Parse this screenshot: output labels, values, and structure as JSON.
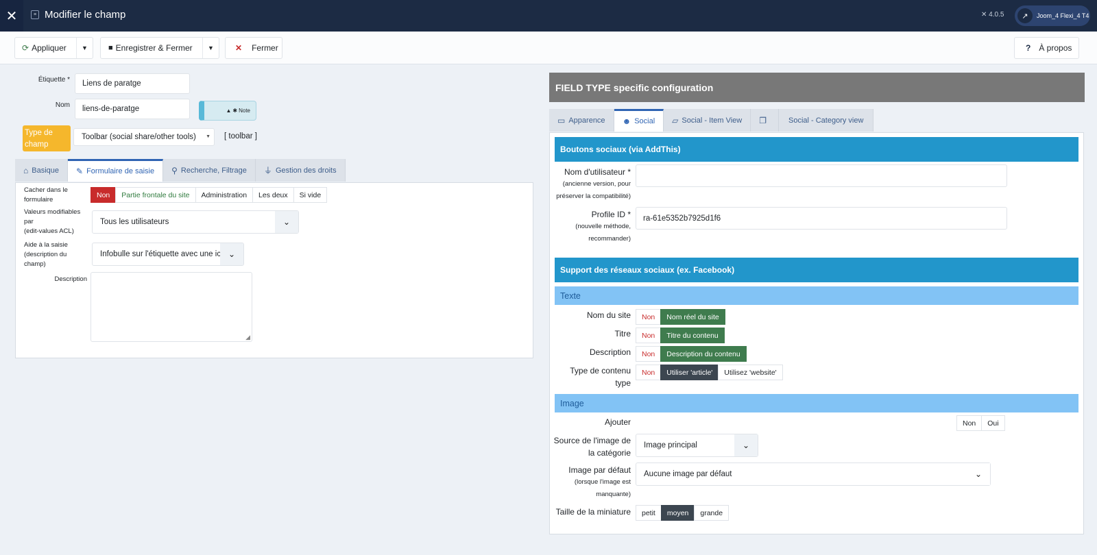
{
  "header": {
    "title": "Modifier le champ",
    "version": "4.0.5",
    "site_name": "Joom_4 Flexi_4 T4"
  },
  "toolbar": {
    "apply": "Appliquer",
    "save_close": "Enregistrer & Fermer",
    "close": "Fermer",
    "about": "À propos"
  },
  "form": {
    "label_label": "Étiquette *",
    "label_value": "Liens de paratge",
    "name_label": "Nom",
    "name_value": "liens-de-paratge",
    "note": "Note",
    "type_label": "Type de champ",
    "type_value": "Toolbar (social share/other tools)",
    "type_code": "[ toolbar ]"
  },
  "left_tabs": [
    {
      "label": "Basique",
      "icon": "home-icon"
    },
    {
      "label": "Formulaire de saisie",
      "icon": "edit-icon"
    },
    {
      "label": "Recherche, Filtrage",
      "icon": "search-icon"
    },
    {
      "label": "Gestion des droits",
      "icon": "plug-icon"
    }
  ],
  "entry_form": {
    "hide_label": "Cacher dans le formulaire",
    "hide_options": [
      "Non",
      "Partie frontale du site",
      "Administration",
      "Les deux",
      "Si vide"
    ],
    "edit_label_1": "Valeurs modifiables par",
    "edit_label_2": "(edit-values ACL)",
    "edit_value": "Tous les utilisateurs",
    "help_label": "Aide à la saisie (description du champ)",
    "help_value": "Infobulle sur l'étiquette avec une icône",
    "description_label": "Description"
  },
  "field_type": {
    "title": "FIELD TYPE specific configuration",
    "tabs": [
      "Apparence",
      "Social",
      "Social - Item View",
      "",
      "Social - Category view"
    ]
  },
  "social": {
    "addthis_title": "Boutons sociaux (via AddThis)",
    "username_label": "Nom d'utilisateur *",
    "username_sub": "(ancienne version, pour préserver la compatibilité)",
    "profile_label": "Profile ID *",
    "profile_sub": "(nouvelle méthode, recommander)",
    "profile_value": "ra-61e5352b7925d1f6",
    "support_title": "Support des réseaux sociaux (ex. Facebook)",
    "text_section": "Texte",
    "site_name_label": "Nom du site",
    "site_name_opts": [
      "Non",
      "Nom réel du site"
    ],
    "title_label": "Titre",
    "title_opts": [
      "Non",
      "Titre du contenu"
    ],
    "desc_label": "Description",
    "desc_opts": [
      "Non",
      "Description du contenu"
    ],
    "ctype_label": "Type de contenu type",
    "ctype_opts": [
      "Non",
      "Utiliser 'article'",
      "Utilisez 'website'"
    ],
    "image_section": "Image",
    "add_label": "Ajouter",
    "add_opts": [
      "Non",
      "Oui"
    ],
    "cat_src_label": "Source de l'image de la catégorie",
    "cat_src_value": "Image principal",
    "default_img_label": "Image par défaut",
    "default_img_sub": "(lorsque l'image est manquante)",
    "default_img_value": "Aucune image par défaut",
    "thumb_label": "Taille de la miniature",
    "thumb_opts": [
      "petit",
      "moyen",
      "grande"
    ]
  }
}
